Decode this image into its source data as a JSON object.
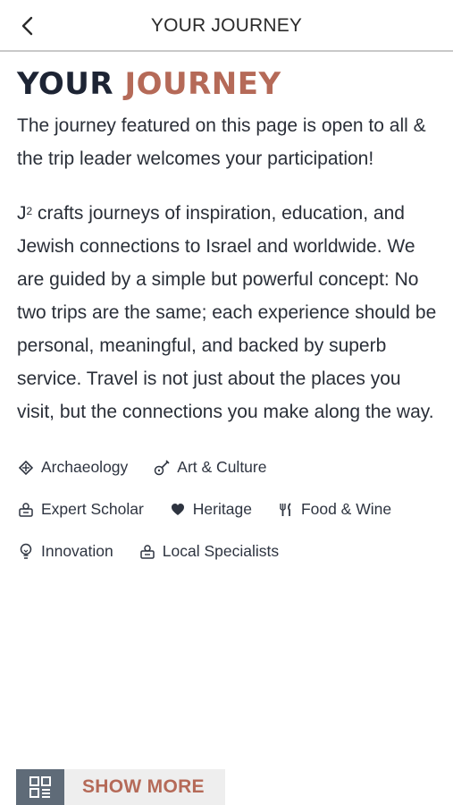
{
  "nav": {
    "title": "YOUR JOURNEY"
  },
  "heading": {
    "part1": "YOUR",
    "part2": "JOURNEY"
  },
  "intro": "The journey featured on this page is open to all & the trip leader welcomes your participation!",
  "description": {
    "brand": "J",
    "brand_sup": "2",
    "text": " crafts journeys of inspiration, education, and Jewish connections to Israel and worldwide. We are guided by a simple but powerful concept: No two trips are the same; each experience should be personal, meaningful, and backed by superb service. Travel is not just about the places you visit, but the connections you make along the way."
  },
  "tags": [
    {
      "label": "Archaeology",
      "icon": "archaeology-icon"
    },
    {
      "label": "Art & Culture",
      "icon": "guitar-icon"
    },
    {
      "label": "Expert Scholar",
      "icon": "scholar-icon"
    },
    {
      "label": "Heritage",
      "icon": "heart-icon"
    },
    {
      "label": "Food & Wine",
      "icon": "fork-knife-icon"
    },
    {
      "label": "Innovation",
      "icon": "lightbulb-icon"
    },
    {
      "label": "Local Specialists",
      "icon": "specialist-icon"
    }
  ],
  "show_more": {
    "label": "SHOW MORE"
  },
  "colors": {
    "accent": "#b56a58",
    "heading_dark": "#1d2434",
    "button_square": "#5f6b78"
  }
}
